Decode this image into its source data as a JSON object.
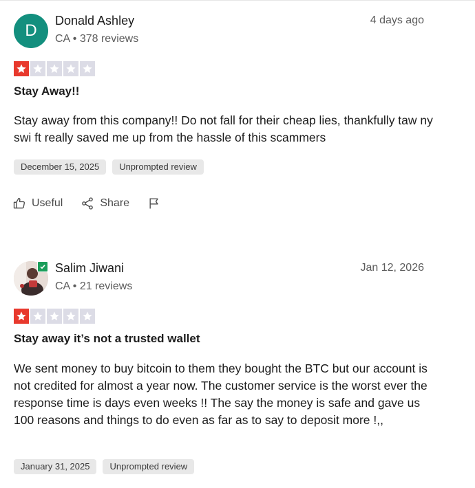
{
  "reviews": [
    {
      "avatar_letter": "D",
      "avatar_color": "#138f7e",
      "name": "Donald Ashley",
      "meta": "CA • 378 reviews",
      "date": "4 days ago",
      "rating": 1,
      "title": "Stay Away!!",
      "body": "Stay away from this company!! Do not fall for their cheap lies, thankfully taw ny swi ft really saved me up from the hassle of this scammers",
      "tags": [
        "December 15, 2025",
        "Unprompted review"
      ],
      "actions": {
        "useful": "Useful",
        "share": "Share",
        "flag_icon": "flag-icon"
      }
    },
    {
      "avatar_letter": "",
      "verified": true,
      "name": "Salim Jiwani",
      "meta": "CA • 21 reviews",
      "date": "Jan 12, 2026",
      "rating": 1,
      "title": "Stay away it’s not a trusted wallet",
      "body": "We sent money to buy bitcoin to them they bought the BTC but our account is not credited for almost a year now. The customer service is the worst ever the response time is days even weeks !! The say the money is safe and gave us 100 reasons and things to do even as far as to say to deposit more !,,",
      "tags": [
        "January 31, 2025",
        "Unprompted review"
      ]
    }
  ],
  "colors": {
    "star_on": "#e8392d",
    "star_off": "#dcdce6",
    "verified": "#1a9d5a"
  }
}
